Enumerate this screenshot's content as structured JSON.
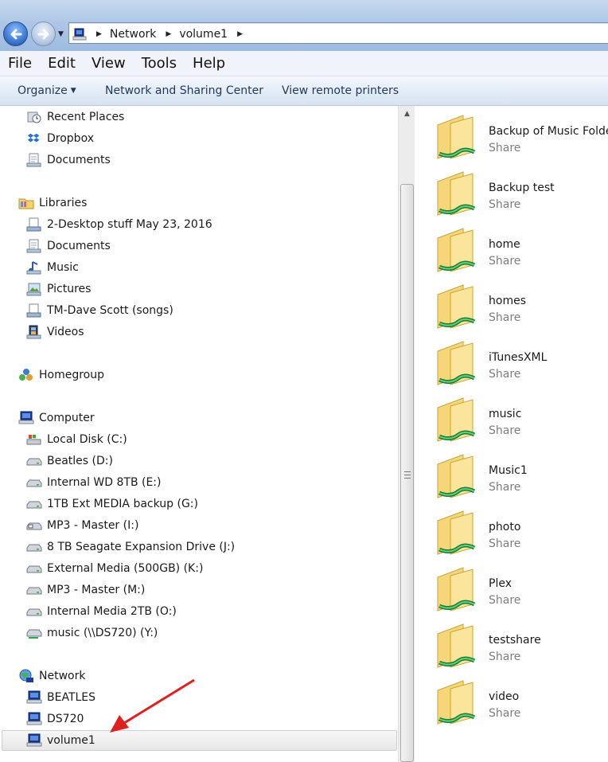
{
  "address": {
    "breadcrumbs": [
      "Network",
      "volume1"
    ]
  },
  "menu": [
    "File",
    "Edit",
    "View",
    "Tools",
    "Help"
  ],
  "commands": {
    "organize": "Organize",
    "network_sharing": "Network and Sharing Center",
    "remote_printers": "View remote printers"
  },
  "nav": {
    "favorites": [
      {
        "label": "Recent Places",
        "icon": "recent-places-icon"
      },
      {
        "label": "Dropbox",
        "icon": "dropbox-icon"
      },
      {
        "label": "Documents",
        "icon": "documents-icon"
      }
    ],
    "libraries": {
      "label": "Libraries",
      "items": [
        {
          "label": "2-Desktop stuff May 23, 2016",
          "icon": "library-icon"
        },
        {
          "label": "Documents",
          "icon": "documents-icon"
        },
        {
          "label": "Music",
          "icon": "music-icon"
        },
        {
          "label": "Pictures",
          "icon": "pictures-icon"
        },
        {
          "label": "TM-Dave Scott (songs)",
          "icon": "library-icon"
        },
        {
          "label": "Videos",
          "icon": "videos-icon"
        }
      ]
    },
    "homegroup": {
      "label": "Homegroup"
    },
    "computer": {
      "label": "Computer",
      "items": [
        {
          "label": "Local Disk (C:)",
          "icon": "system-drive-icon"
        },
        {
          "label": "Beatles (D:)",
          "icon": "drive-icon"
        },
        {
          "label": "Internal WD 8TB (E:)",
          "icon": "drive-icon"
        },
        {
          "label": "1TB Ext MEDIA backup (G:)",
          "icon": "drive-icon"
        },
        {
          "label": "MP3 - Master (I:)",
          "icon": "drive-icon"
        },
        {
          "label": "8 TB Seagate Expansion Drive (J:)",
          "icon": "drive-icon"
        },
        {
          "label": "External Media (500GB) (K:)",
          "icon": "drive-icon"
        },
        {
          "label": "MP3 - Master (M:)",
          "icon": "drive-icon"
        },
        {
          "label": "Internal Media 2TB (O:)",
          "icon": "drive-icon"
        },
        {
          "label": "music (\\\\DS720) (Y:)",
          "icon": "network-drive-icon"
        }
      ]
    },
    "network": {
      "label": "Network",
      "items": [
        {
          "label": "BEATLES",
          "icon": "network-computer-icon"
        },
        {
          "label": "DS720",
          "icon": "network-computer-icon"
        },
        {
          "label": "volume1",
          "icon": "network-computer-icon",
          "selected": true
        }
      ]
    }
  },
  "shares": [
    {
      "name": "Backup of Music Folder",
      "type": "Share"
    },
    {
      "name": "Backup test",
      "type": "Share"
    },
    {
      "name": "home",
      "type": "Share"
    },
    {
      "name": "homes",
      "type": "Share"
    },
    {
      "name": "iTunesXML",
      "type": "Share"
    },
    {
      "name": "music",
      "type": "Share"
    },
    {
      "name": "Music1",
      "type": "Share"
    },
    {
      "name": "photo",
      "type": "Share"
    },
    {
      "name": "Plex",
      "type": "Share"
    },
    {
      "name": "testshare",
      "type": "Share"
    },
    {
      "name": "video",
      "type": "Share"
    }
  ],
  "colors": {
    "address_bar": "#aec6e6",
    "command_text": "#1e395b",
    "share_type_text": "#7d7d7d",
    "annotation_arrow": "#e02020",
    "share_pipe": "#2fa84f"
  }
}
